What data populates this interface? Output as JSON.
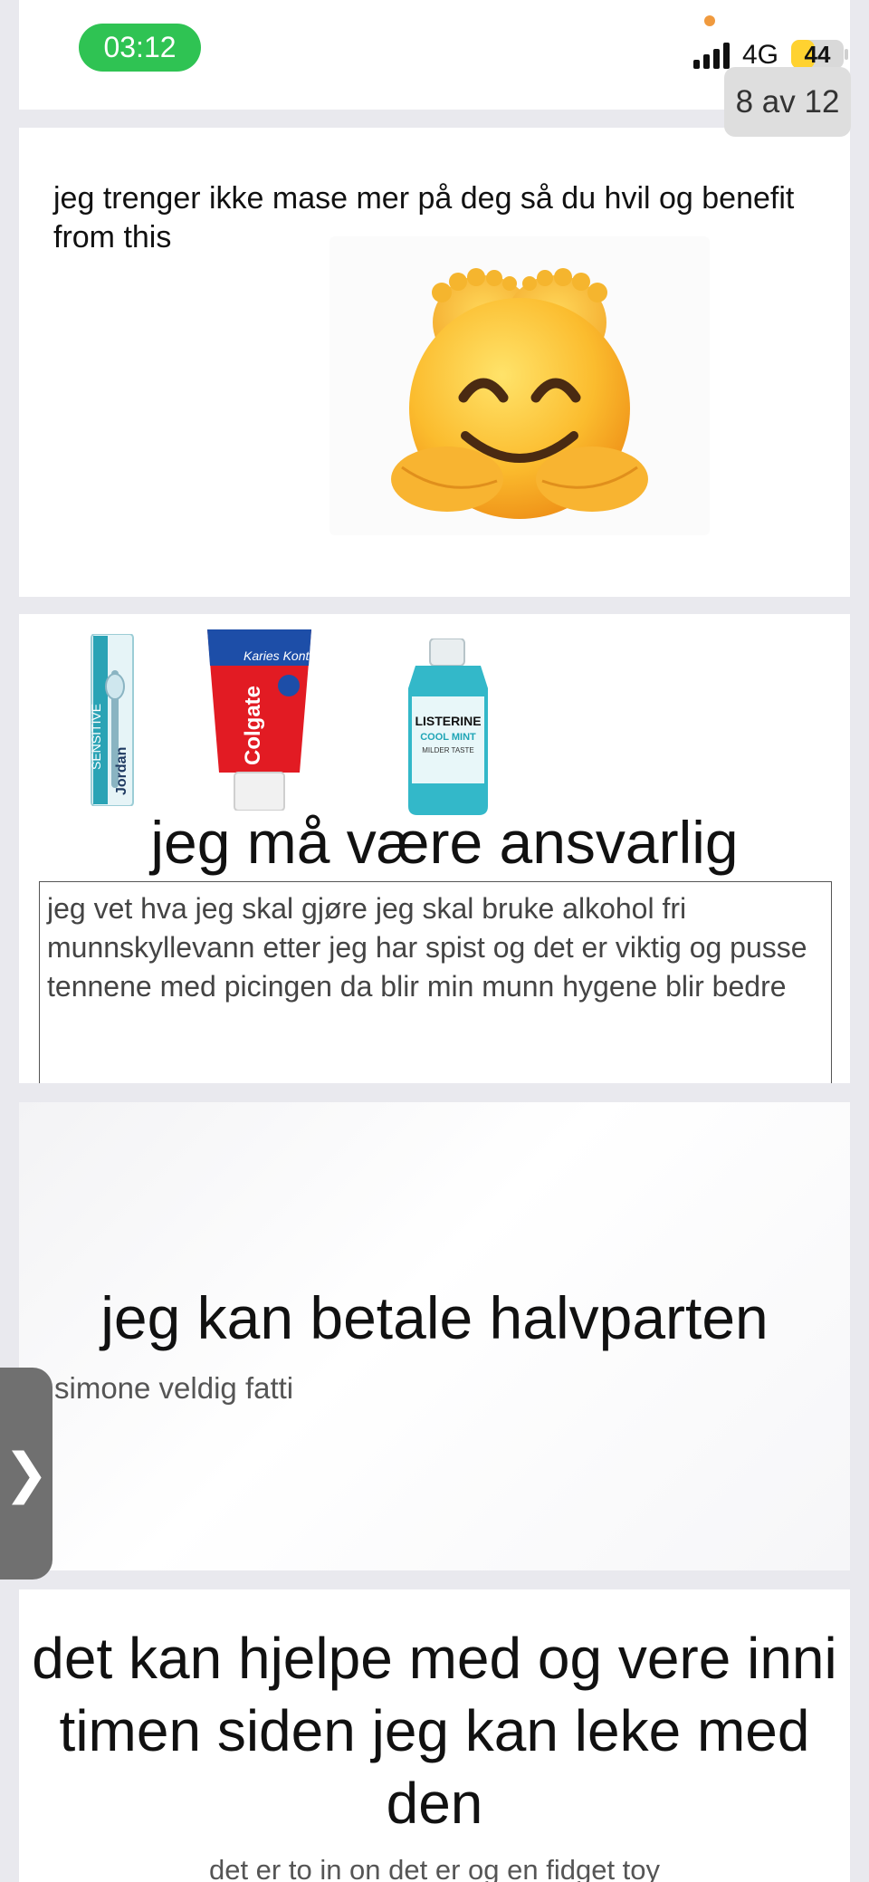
{
  "status_bar": {
    "time": "03:12",
    "network": "4G",
    "battery": "44",
    "battery_level": 0.44
  },
  "pager": {
    "counter": "8 av 12"
  },
  "slides": [
    {
      "text": "jeg trenger ikke mase mer på deg så du hvil og benefit from this",
      "emoji": "smiling-face-with-feet-icon"
    },
    {
      "products": [
        {
          "icon": "toothbrush-icon",
          "label": "Jordan",
          "tag": "SENSITIVE"
        },
        {
          "icon": "toothpaste-icon",
          "label": "Colgate",
          "tag": "Karies Kontroll"
        },
        {
          "icon": "mouthwash-icon",
          "label": "LISTERINE",
          "tag": "COOL MINT",
          "note": "MILDER TASTE"
        }
      ],
      "title": "jeg må være ansvarlig",
      "body": "jeg vet hva jeg skal gjøre jeg skal bruke alkohol fri munnskyllevann etter jeg har spist og det er viktig og pusse tennene med picingen da blir min munn hygene blir bedre"
    },
    {
      "title": "jeg kan betale halvparten",
      "subtitle": "simone veldig fatti"
    },
    {
      "title": "det kan hjelpe med og vere inni timen siden jeg kan leke med den",
      "subtitle": "det er to in on det er og en fidget toy"
    }
  ],
  "side_tab": {
    "label": "❯",
    "icon": "chevron-right-icon"
  },
  "colors": {
    "clock_pill": "#2fc353",
    "battery": "#ffd230",
    "orange_dot": "#f09a3e",
    "background": "#e9e9ee"
  }
}
